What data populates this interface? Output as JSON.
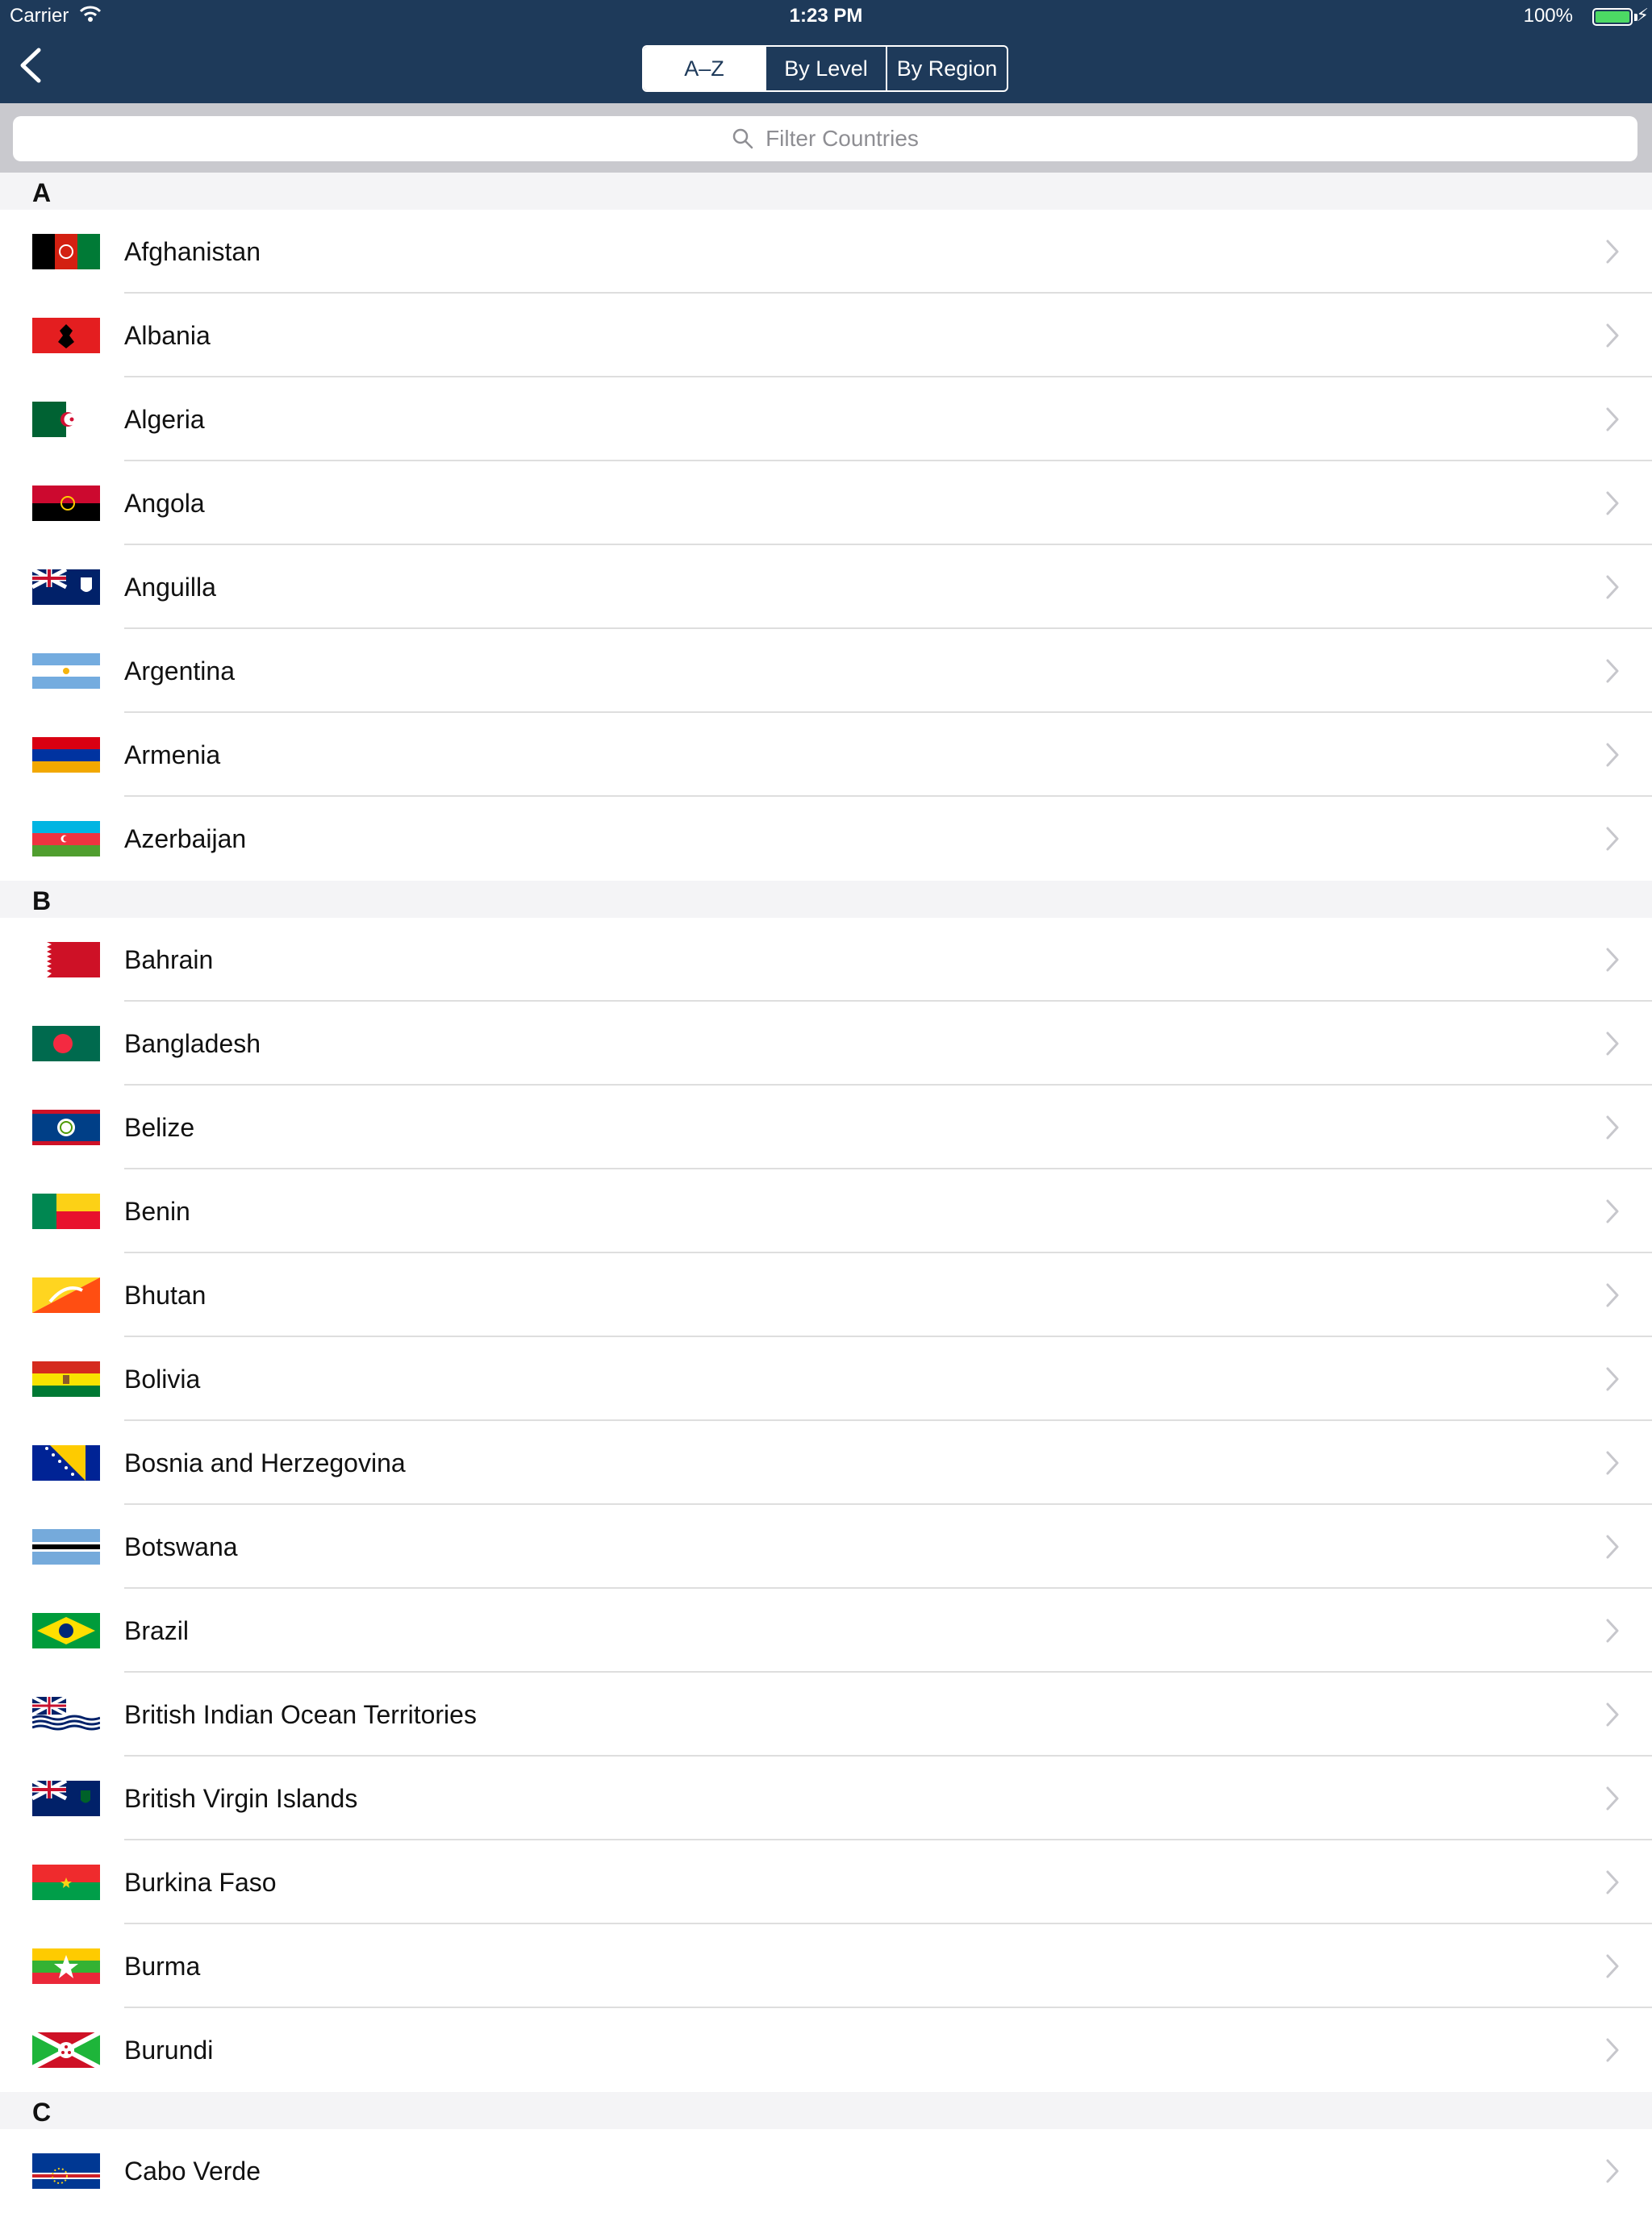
{
  "status_bar": {
    "carrier": "Carrier",
    "time": "1:23 PM",
    "battery": "100%",
    "battery_level": 1.0,
    "battery_color": "#4cd964"
  },
  "nav": {
    "background": "#1e3a5a",
    "back_icon": "chevron-left-icon",
    "segments": [
      {
        "label": "A–Z",
        "selected": true
      },
      {
        "label": "By Level",
        "selected": false
      },
      {
        "label": "By Region",
        "selected": false
      }
    ]
  },
  "search": {
    "icon": "search-icon",
    "placeholder": "Filter Countries"
  },
  "sections": [
    {
      "letter": "A",
      "countries": [
        {
          "name": "Afghanistan"
        },
        {
          "name": "Albania"
        },
        {
          "name": "Algeria"
        },
        {
          "name": "Angola"
        },
        {
          "name": "Anguilla"
        },
        {
          "name": "Argentina"
        },
        {
          "name": "Armenia"
        },
        {
          "name": "Azerbaijan"
        }
      ]
    },
    {
      "letter": "B",
      "countries": [
        {
          "name": "Bahrain"
        },
        {
          "name": "Bangladesh"
        },
        {
          "name": "Belize"
        },
        {
          "name": "Benin"
        },
        {
          "name": "Bhutan"
        },
        {
          "name": "Bolivia"
        },
        {
          "name": "Bosnia and Herzegovina"
        },
        {
          "name": "Botswana"
        },
        {
          "name": "Brazil"
        },
        {
          "name": "British Indian Ocean Territories"
        },
        {
          "name": "British Virgin Islands"
        },
        {
          "name": "Burkina Faso"
        },
        {
          "name": "Burma"
        },
        {
          "name": "Burundi"
        }
      ]
    },
    {
      "letter": "C",
      "countries": [
        {
          "name": "Cabo Verde"
        }
      ]
    }
  ]
}
